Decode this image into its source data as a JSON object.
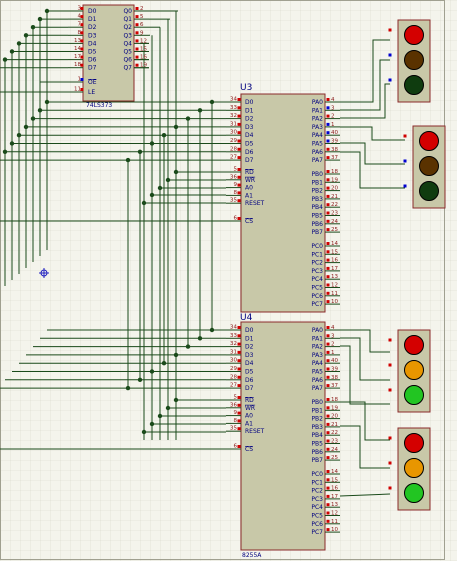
{
  "latch": {
    "name": "74LS373",
    "inputs": [
      {
        "num": "3",
        "name": "D0"
      },
      {
        "num": "4",
        "name": "D1"
      },
      {
        "num": "7",
        "name": "D2"
      },
      {
        "num": "8",
        "name": "D3"
      },
      {
        "num": "13",
        "name": "D4"
      },
      {
        "num": "14",
        "name": "D5"
      },
      {
        "num": "17",
        "name": "D6"
      },
      {
        "num": "18",
        "name": "D7"
      }
    ],
    "outputs": [
      {
        "num": "2",
        "name": "Q0"
      },
      {
        "num": "5",
        "name": "Q1"
      },
      {
        "num": "6",
        "name": "Q2"
      },
      {
        "num": "9",
        "name": "Q3"
      },
      {
        "num": "12",
        "name": "Q4"
      },
      {
        "num": "15",
        "name": "Q5"
      },
      {
        "num": "16",
        "name": "Q6"
      },
      {
        "num": "19",
        "name": "Q7"
      }
    ],
    "controls": [
      {
        "num": "1",
        "name": "OE"
      },
      {
        "num": "11",
        "name": "LE"
      }
    ]
  },
  "u3": {
    "ref": "U3",
    "left_data": [
      {
        "num": "34",
        "name": "D0"
      },
      {
        "num": "33",
        "name": "D1"
      },
      {
        "num": "32",
        "name": "D2"
      },
      {
        "num": "31",
        "name": "D3"
      },
      {
        "num": "30",
        "name": "D4"
      },
      {
        "num": "29",
        "name": "D5"
      },
      {
        "num": "28",
        "name": "D6"
      },
      {
        "num": "27",
        "name": "D7"
      }
    ],
    "left_ctrl": [
      {
        "num": "5",
        "name": "RD"
      },
      {
        "num": "36",
        "name": "WR"
      },
      {
        "num": "9",
        "name": "A0"
      },
      {
        "num": "8",
        "name": "A1"
      },
      {
        "num": "35",
        "name": "RESET"
      }
    ],
    "cs": {
      "num": "6",
      "name": "CS"
    },
    "pa": [
      {
        "num": "4",
        "name": "PA0"
      },
      {
        "num": "3",
        "name": "PA1"
      },
      {
        "num": "2",
        "name": "PA2"
      },
      {
        "num": "1",
        "name": "PA3"
      },
      {
        "num": "40",
        "name": "PA4"
      },
      {
        "num": "39",
        "name": "PA5"
      },
      {
        "num": "38",
        "name": "PA6"
      },
      {
        "num": "37",
        "name": "PA7"
      }
    ],
    "pb": [
      {
        "num": "18",
        "name": "PB0"
      },
      {
        "num": "19",
        "name": "PB1"
      },
      {
        "num": "20",
        "name": "PB2"
      },
      {
        "num": "21",
        "name": "PB3"
      },
      {
        "num": "22",
        "name": "PB4"
      },
      {
        "num": "23",
        "name": "PB5"
      },
      {
        "num": "24",
        "name": "PB6"
      },
      {
        "num": "25",
        "name": "PB7"
      }
    ],
    "pc": [
      {
        "num": "14",
        "name": "PC0"
      },
      {
        "num": "15",
        "name": "PC1"
      },
      {
        "num": "16",
        "name": "PC2"
      },
      {
        "num": "17",
        "name": "PC3"
      },
      {
        "num": "13",
        "name": "PC4"
      },
      {
        "num": "12",
        "name": "PC5"
      },
      {
        "num": "11",
        "name": "PC6"
      },
      {
        "num": "10",
        "name": "PC7"
      }
    ]
  },
  "u4": {
    "ref": "U4",
    "part": "8255A",
    "left_data": [
      {
        "num": "34",
        "name": "D0"
      },
      {
        "num": "33",
        "name": "D1"
      },
      {
        "num": "32",
        "name": "D2"
      },
      {
        "num": "31",
        "name": "D3"
      },
      {
        "num": "30",
        "name": "D4"
      },
      {
        "num": "29",
        "name": "D5"
      },
      {
        "num": "28",
        "name": "D6"
      },
      {
        "num": "27",
        "name": "D7"
      }
    ],
    "left_ctrl": [
      {
        "num": "5",
        "name": "RD"
      },
      {
        "num": "36",
        "name": "WR"
      },
      {
        "num": "9",
        "name": "A0"
      },
      {
        "num": "8",
        "name": "A1"
      },
      {
        "num": "35",
        "name": "RESET"
      }
    ],
    "cs": {
      "num": "6",
      "name": "CS"
    },
    "pa": [
      {
        "num": "4",
        "name": "PA0"
      },
      {
        "num": "3",
        "name": "PA1"
      },
      {
        "num": "2",
        "name": "PA2"
      },
      {
        "num": "1",
        "name": "PA3"
      },
      {
        "num": "40",
        "name": "PA4"
      },
      {
        "num": "39",
        "name": "PA5"
      },
      {
        "num": "38",
        "name": "PA6"
      },
      {
        "num": "37",
        "name": "PA7"
      }
    ],
    "pb": [
      {
        "num": "18",
        "name": "PB0"
      },
      {
        "num": "19",
        "name": "PB1"
      },
      {
        "num": "20",
        "name": "PB2"
      },
      {
        "num": "21",
        "name": "PB3"
      },
      {
        "num": "22",
        "name": "PB4"
      },
      {
        "num": "23",
        "name": "PB5"
      },
      {
        "num": "24",
        "name": "PB6"
      },
      {
        "num": "25",
        "name": "PB7"
      }
    ],
    "pc": [
      {
        "num": "14",
        "name": "PC0"
      },
      {
        "num": "15",
        "name": "PC1"
      },
      {
        "num": "16",
        "name": "PC2"
      },
      {
        "num": "17",
        "name": "PC3"
      },
      {
        "num": "13",
        "name": "PC4"
      },
      {
        "num": "12",
        "name": "PC5"
      },
      {
        "num": "11",
        "name": "PC6"
      },
      {
        "num": "10",
        "name": "PC7"
      }
    ]
  },
  "traffic_lights": [
    {
      "id": "tl1",
      "lamps": [
        "#d40000",
        "#5a3200",
        "#0f3c0f"
      ]
    },
    {
      "id": "tl2",
      "lamps": [
        "#d40000",
        "#5a3200",
        "#0f3c0f"
      ]
    },
    {
      "id": "tl3",
      "lamps": [
        "#d40000",
        "#e89600",
        "#22c522"
      ]
    },
    {
      "id": "tl4",
      "lamps": [
        "#d40000",
        "#e89600",
        "#22c522"
      ]
    }
  ],
  "colors": {
    "background": "#f4f4ec",
    "grid": "#d7d7c9",
    "chip_fill": "#c8c8a8",
    "chip_border": "#8a2a2a",
    "wire": "#1a4a1a",
    "pin_num": "#8a1a1a",
    "label": "#000080",
    "pin_marker": "#d00000",
    "bus_marker": "#0000d0"
  }
}
